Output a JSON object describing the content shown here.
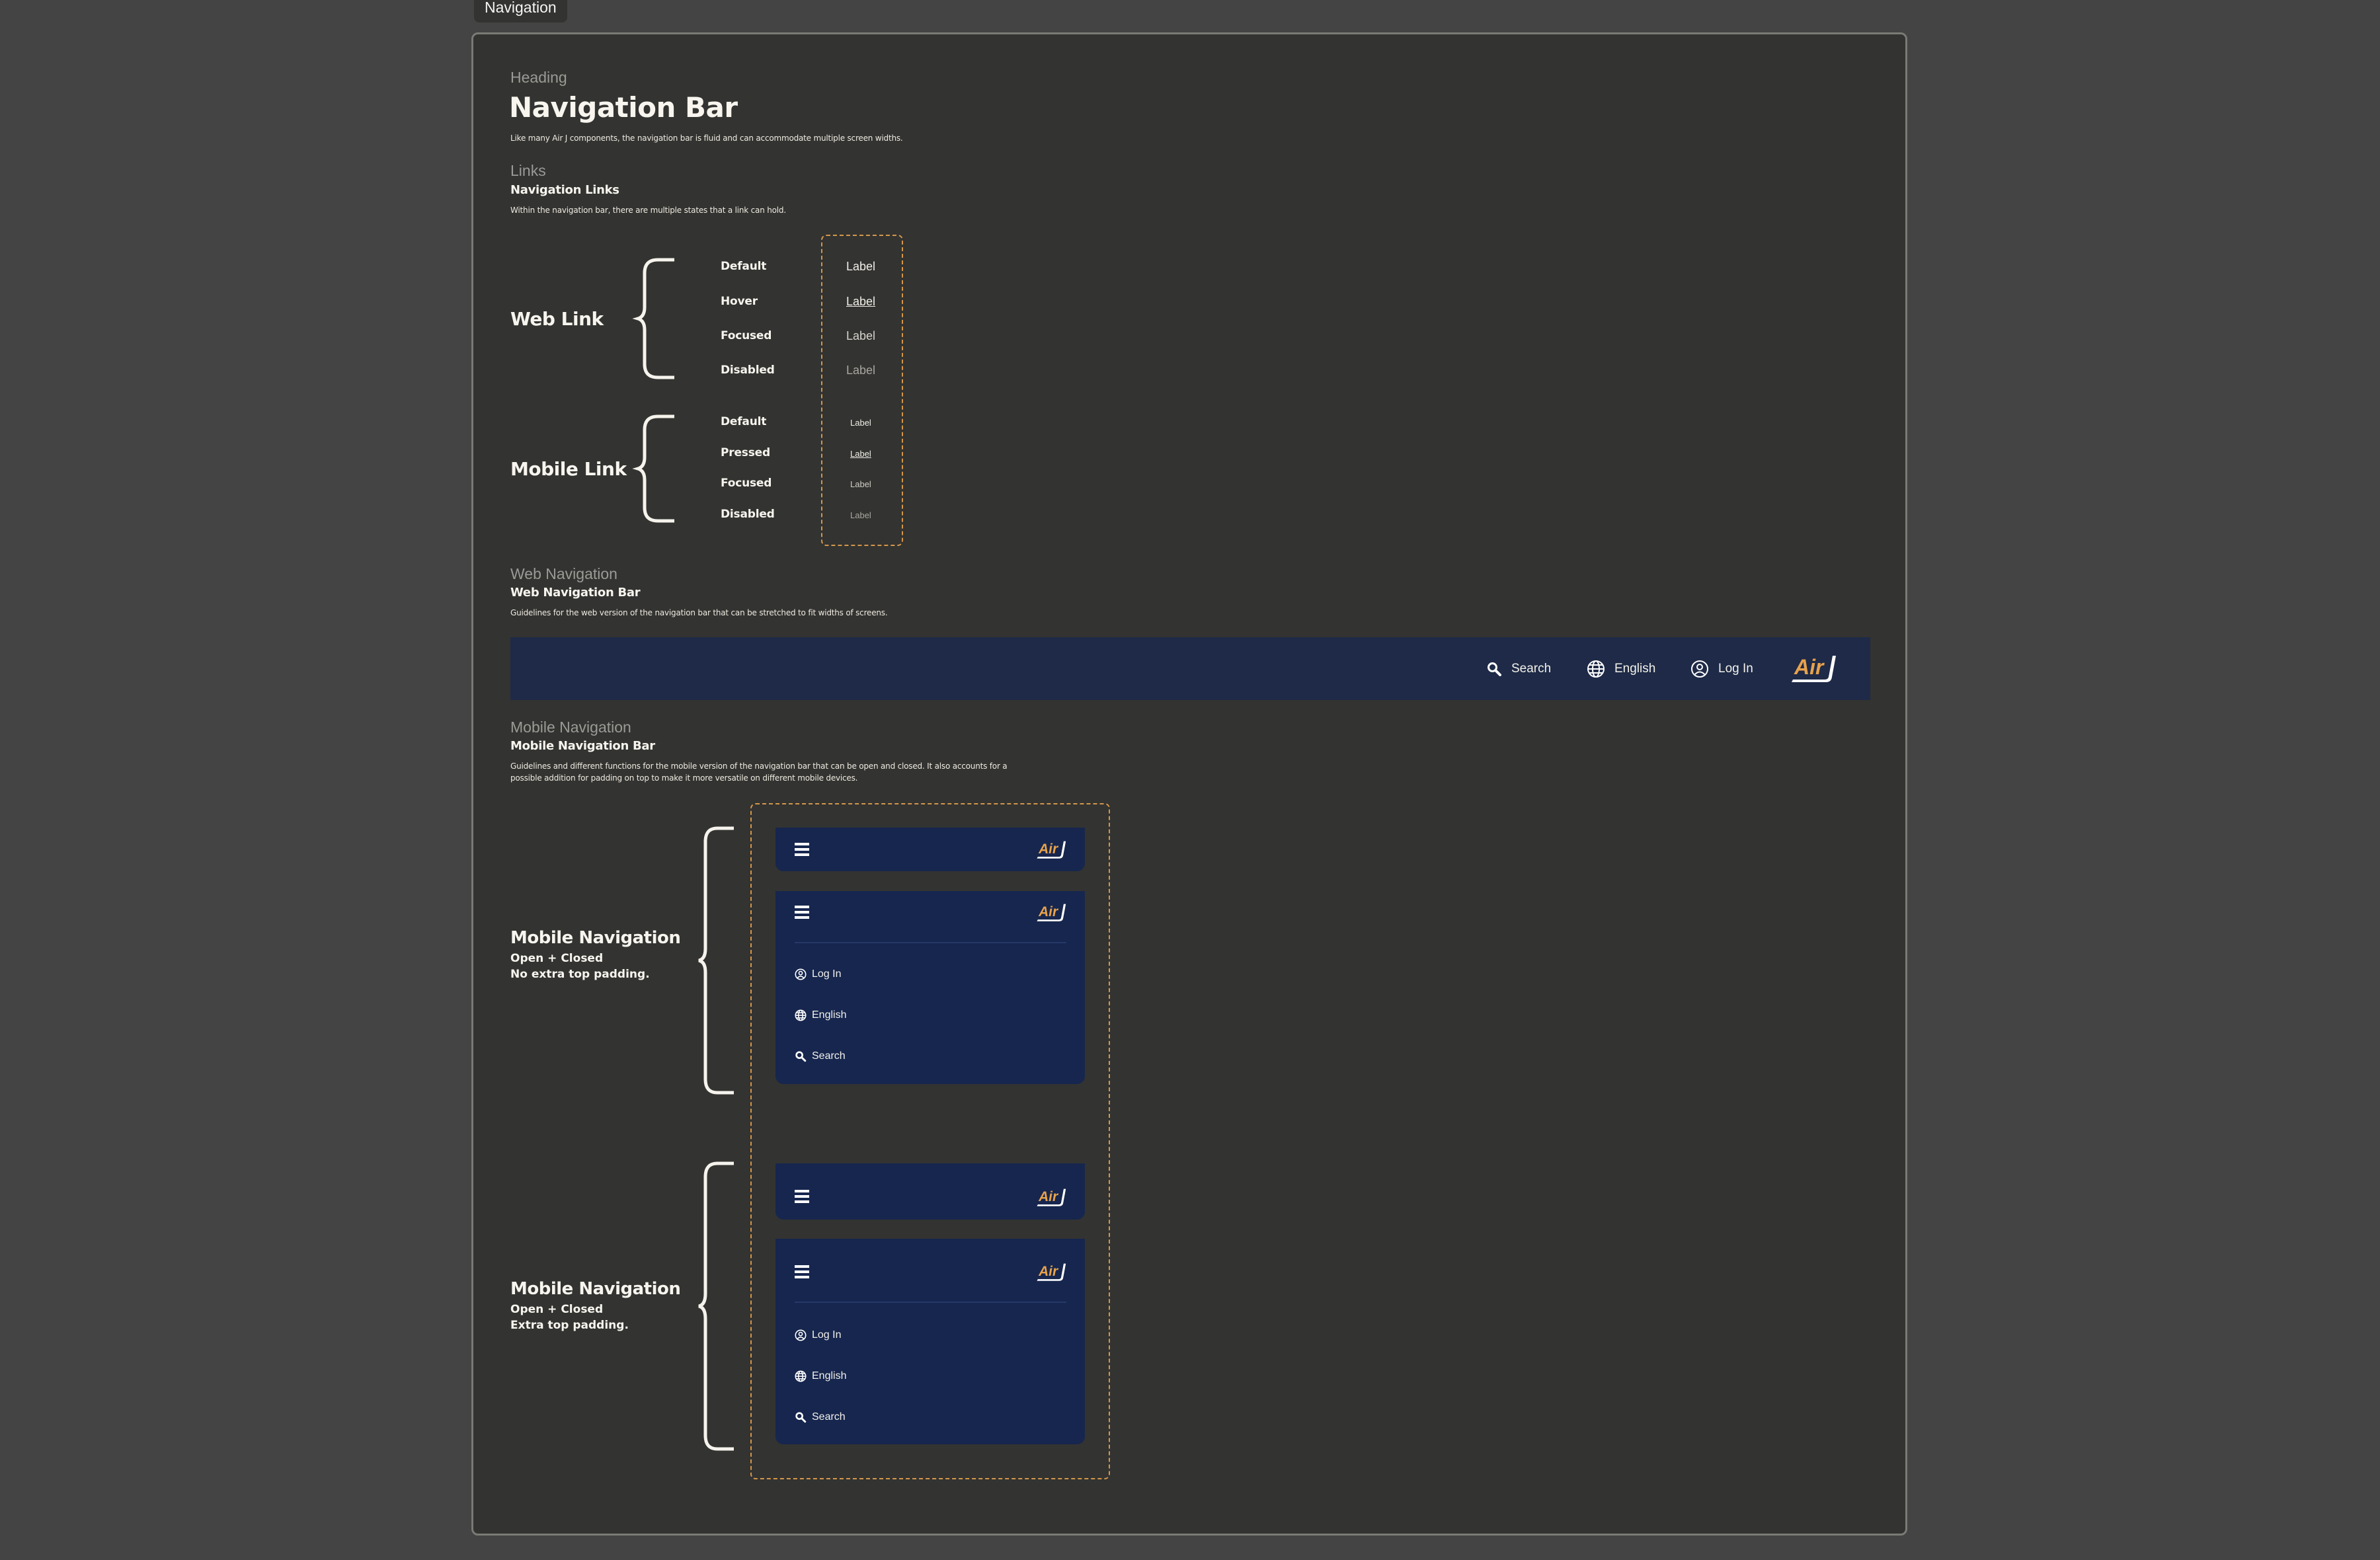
{
  "tab": {
    "label": "Navigation"
  },
  "heading": {
    "eyebrow": "Heading",
    "title": "Navigation Bar",
    "description": "Like many Air J components, the navigation bar is fluid and can accommodate multiple screen widths."
  },
  "links": {
    "eyebrow": "Links",
    "title": "Navigation Links",
    "description": "Within the navigation bar, there are multiple states that a link can hold.",
    "web": {
      "group_label": "Web Link",
      "states": [
        {
          "state": "Default",
          "label": "Label"
        },
        {
          "state": "Hover",
          "label": "Label"
        },
        {
          "state": "Focused",
          "label": "Label"
        },
        {
          "state": "Disabled",
          "label": "Label"
        }
      ]
    },
    "mobile": {
      "group_label": "Mobile Link",
      "states": [
        {
          "state": "Default",
          "label": "Label"
        },
        {
          "state": "Pressed",
          "label": "Label"
        },
        {
          "state": "Focused",
          "label": "Label"
        },
        {
          "state": "Disabled",
          "label": "Label"
        }
      ]
    }
  },
  "web_navigation": {
    "eyebrow": "Web Navigation",
    "title": "Web Navigation Bar",
    "description": "Guidelines for the web version of the navigation bar that can be stretched to fit widths of screens.",
    "items": [
      {
        "icon": "search-icon",
        "label": "Search"
      },
      {
        "icon": "globe-icon",
        "label": "English"
      },
      {
        "icon": "user-circle-icon",
        "label": "Log In"
      }
    ],
    "logo": {
      "text_primary": "Air",
      "text_secondary": "J"
    }
  },
  "mobile_navigation": {
    "eyebrow": "Mobile Navigation",
    "title": "Mobile Navigation Bar",
    "description_line1": "Guidelines and different functions for the mobile version of the navigation bar that can be open and closed. It also accounts for a",
    "description_line2": "possible addition for padding on top to make it more versatile on different mobile devices.",
    "variants": [
      {
        "title": "Mobile Navigation",
        "line1": "Open + Closed",
        "line2": "No extra top padding."
      },
      {
        "title": "Mobile Navigation",
        "line1": "Open + Closed",
        "line2": "Extra top padding."
      }
    ],
    "menu_items": [
      {
        "icon": "user-circle-icon",
        "label": "Log In"
      },
      {
        "icon": "globe-icon",
        "label": "English"
      },
      {
        "icon": "search-icon",
        "label": "Search"
      }
    ]
  },
  "colors": {
    "page_bg": "#444444",
    "frame_bg": "#333331",
    "web_nav_bg": "#1e2a47",
    "mobile_nav_bg": "#16264e",
    "accent_orange": "#e8a24c",
    "dashed_outline": "#d4974a",
    "text": "#f7f5ee"
  }
}
